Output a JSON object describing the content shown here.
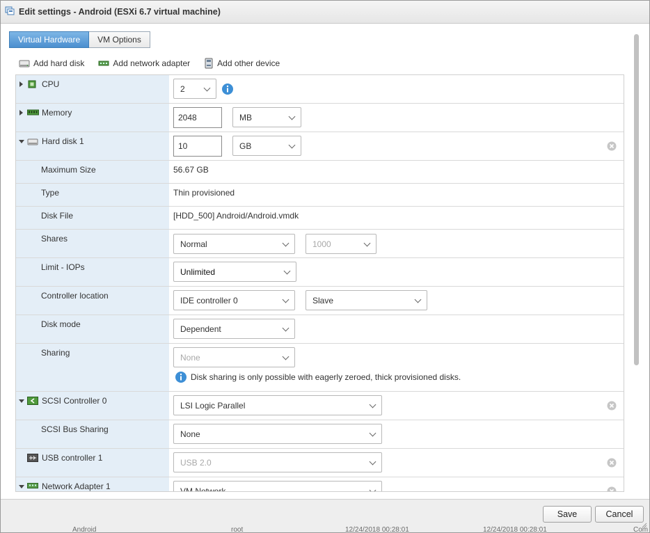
{
  "window": {
    "title": "Edit settings - Android (ESXi 6.7 virtual machine)"
  },
  "tabs": [
    {
      "label": "Virtual Hardware",
      "active": true
    },
    {
      "label": "VM Options",
      "active": false
    }
  ],
  "toolbar": {
    "add_hard_disk": "Add hard disk",
    "add_network_adapter": "Add network adapter",
    "add_other_device": "Add other device"
  },
  "hardware": {
    "cpu": {
      "label": "CPU",
      "value": "2"
    },
    "memory": {
      "label": "Memory",
      "value": "2048",
      "unit": "MB"
    },
    "hard_disk": {
      "label": "Hard disk 1",
      "value": "10",
      "unit": "GB",
      "max_size": {
        "label": "Maximum Size",
        "value": "56.67 GB"
      },
      "type": {
        "label": "Type",
        "value": "Thin provisioned"
      },
      "disk_file": {
        "label": "Disk File",
        "value": "[HDD_500] Android/Android.vmdk"
      },
      "shares": {
        "label": "Shares",
        "value": "Normal",
        "amount": "1000"
      },
      "limit_iops": {
        "label": "Limit - IOPs",
        "value": "Unlimited"
      },
      "controller_location": {
        "label": "Controller location",
        "controller": "IDE controller 0",
        "position": "Slave"
      },
      "disk_mode": {
        "label": "Disk mode",
        "value": "Dependent"
      },
      "sharing": {
        "label": "Sharing",
        "value": "None",
        "note": "Disk sharing is only possible with eagerly zeroed, thick provisioned disks."
      }
    },
    "scsi_controller": {
      "label": "SCSI Controller 0",
      "value": "LSI Logic Parallel",
      "bus_sharing": {
        "label": "SCSI Bus Sharing",
        "value": "None"
      }
    },
    "usb_controller": {
      "label": "USB controller 1",
      "value": "USB 2.0"
    },
    "network_adapter": {
      "label": "Network Adapter 1",
      "value": "VM Network"
    }
  },
  "footer": {
    "save": "Save",
    "cancel": "Cancel"
  },
  "background_row": {
    "name": "Android",
    "user": "root",
    "time1": "12/24/2018 00:28:01",
    "time2": "12/24/2018 00:28:01",
    "status": "Com"
  },
  "colors": {
    "tab_active": "#4b8fcf",
    "label_bg": "#e4eef7",
    "info_blue": "#3d8fd6"
  }
}
